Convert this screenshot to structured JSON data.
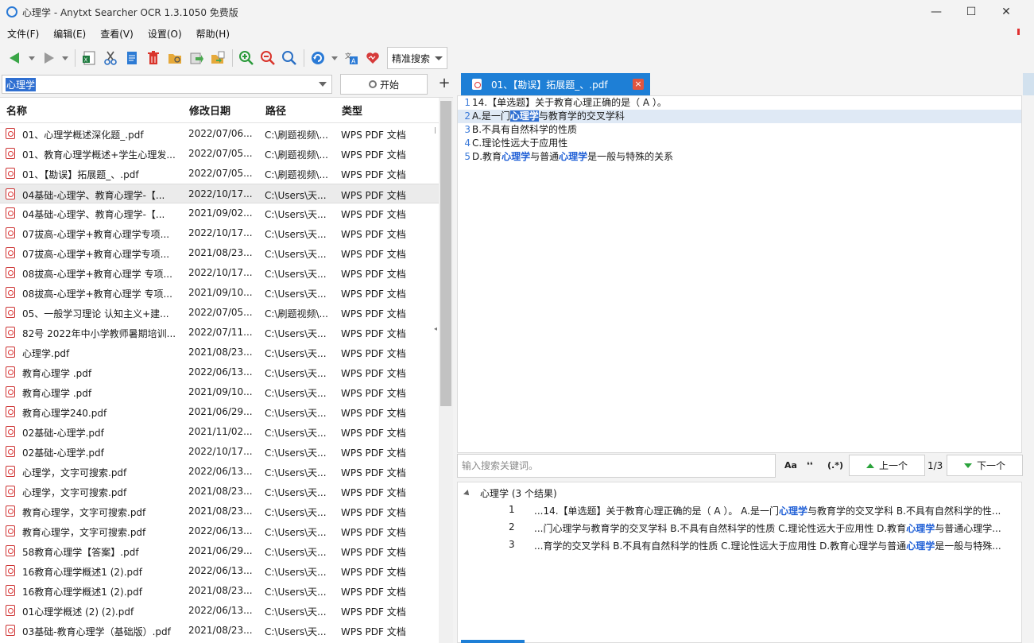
{
  "window": {
    "title": "心理学 - Anytxt Searcher OCR 1.3.1050 免费版",
    "minimize": "—",
    "maximize": "☐",
    "close": "✕"
  },
  "menu": [
    "文件(F)",
    "编辑(E)",
    "查看(V)",
    "设置(O)",
    "帮助(H)"
  ],
  "toolbar": {
    "icons": [
      "back-icon",
      "forward-icon",
      "excel-export-icon",
      "cut-icon",
      "document-icon",
      "delete-icon",
      "open-folder-icon",
      "copy-to-icon",
      "move-to-icon",
      "zoom-in-icon",
      "zoom-out-icon",
      "search-icon",
      "refresh-icon",
      "translate-icon",
      "favorite-icon"
    ],
    "mode": "精准搜索"
  },
  "search": {
    "query": "心理学",
    "start_label": "开始",
    "add_label": "+"
  },
  "tab": {
    "title": "01、【勘误】拓展题_、.pdf",
    "close": "×"
  },
  "list": {
    "headers": {
      "name": "名称",
      "date": "修改日期",
      "path": "路径",
      "type": "类型"
    },
    "selected_index": 3,
    "rows": [
      {
        "name": "01、心理学概述深化题_.pdf",
        "date": "2022/07/06...",
        "path": "C:\\刷题视频\\...",
        "type": "WPS PDF 文档"
      },
      {
        "name": "01、教育心理学概述+学生心理发...",
        "date": "2022/07/05...",
        "path": "C:\\刷题视频\\...",
        "type": "WPS PDF 文档"
      },
      {
        "name": "01、【勘误】拓展题_、.pdf",
        "date": "2022/07/05...",
        "path": "C:\\刷题视频\\...",
        "type": "WPS PDF 文档"
      },
      {
        "name": "04基础-心理学、教育心理学-【...",
        "date": "2022/10/17...",
        "path": "C:\\Users\\天...",
        "type": "WPS PDF 文档"
      },
      {
        "name": "04基础-心理学、教育心理学-【...",
        "date": "2021/09/02...",
        "path": "C:\\Users\\天...",
        "type": "WPS PDF 文档"
      },
      {
        "name": "07拔高-心理学+教育心理学专项...",
        "date": "2022/10/17...",
        "path": "C:\\Users\\天...",
        "type": "WPS PDF 文档"
      },
      {
        "name": "07拔高-心理学+教育心理学专项...",
        "date": "2021/08/23...",
        "path": "C:\\Users\\天...",
        "type": "WPS PDF 文档"
      },
      {
        "name": "08拔高-心理学+教育心理学 专项...",
        "date": "2022/10/17...",
        "path": "C:\\Users\\天...",
        "type": "WPS PDF 文档"
      },
      {
        "name": "08拔高-心理学+教育心理学 专项...",
        "date": "2021/09/10...",
        "path": "C:\\Users\\天...",
        "type": "WPS PDF 文档"
      },
      {
        "name": "05、一般学习理论 认知主义+建...",
        "date": "2022/07/05...",
        "path": "C:\\刷题视频\\...",
        "type": "WPS PDF 文档"
      },
      {
        "name": "82号 2022年中小学教师暑期培训...",
        "date": "2022/07/11...",
        "path": "C:\\Users\\天...",
        "type": "WPS PDF 文档"
      },
      {
        "name": "心理学.pdf",
        "date": "2021/08/23...",
        "path": "C:\\Users\\天...",
        "type": "WPS PDF 文档"
      },
      {
        "name": "教育心理学 .pdf",
        "date": "2022/06/13...",
        "path": "C:\\Users\\天...",
        "type": "WPS PDF 文档"
      },
      {
        "name": "教育心理学 .pdf",
        "date": "2021/09/10...",
        "path": "C:\\Users\\天...",
        "type": "WPS PDF 文档"
      },
      {
        "name": "教育心理学240.pdf",
        "date": "2021/06/29...",
        "path": "C:\\Users\\天...",
        "type": "WPS PDF 文档"
      },
      {
        "name": "02基础-心理学.pdf",
        "date": "2021/11/02...",
        "path": "C:\\Users\\天...",
        "type": "WPS PDF 文档"
      },
      {
        "name": "02基础-心理学.pdf",
        "date": "2022/10/17...",
        "path": "C:\\Users\\天...",
        "type": "WPS PDF 文档"
      },
      {
        "name": "心理学，文字可搜索.pdf",
        "date": "2022/06/13...",
        "path": "C:\\Users\\天...",
        "type": "WPS PDF 文档"
      },
      {
        "name": "心理学，文字可搜索.pdf",
        "date": "2021/08/23...",
        "path": "C:\\Users\\天...",
        "type": "WPS PDF 文档"
      },
      {
        "name": "教育心理学，文字可搜索.pdf",
        "date": "2021/08/23...",
        "path": "C:\\Users\\天...",
        "type": "WPS PDF 文档"
      },
      {
        "name": "教育心理学，文字可搜索.pdf",
        "date": "2022/06/13...",
        "path": "C:\\Users\\天...",
        "type": "WPS PDF 文档"
      },
      {
        "name": "58教育心理学【答案】.pdf",
        "date": "2021/06/29...",
        "path": "C:\\Users\\天...",
        "type": "WPS PDF 文档"
      },
      {
        "name": "16教育心理学概述1 (2).pdf",
        "date": "2022/06/13...",
        "path": "C:\\Users\\天...",
        "type": "WPS PDF 文档"
      },
      {
        "name": "16教育心理学概述1 (2).pdf",
        "date": "2021/08/23...",
        "path": "C:\\Users\\天...",
        "type": "WPS PDF 文档"
      },
      {
        "name": "01心理学概述 (2) (2).pdf",
        "date": "2022/06/13...",
        "path": "C:\\Users\\天...",
        "type": "WPS PDF 文档"
      },
      {
        "name": "03基础-教育心理学（基础版）.pdf",
        "date": "2021/08/23...",
        "path": "C:\\Users\\天...",
        "type": "WPS PDF 文档"
      }
    ]
  },
  "preview": {
    "current_line": 2,
    "lines": [
      [
        {
          "t": "14.【单选题】关于教育心理正确的是（ A ）。"
        }
      ],
      [
        {
          "t": "A.是一门"
        },
        {
          "t": "心理学",
          "h": "box"
        },
        {
          "t": "与教育学的交叉学科"
        }
      ],
      [
        {
          "t": "B.不具有自然科学的性质"
        }
      ],
      [
        {
          "t": "C.理论性远大于应用性"
        }
      ],
      [
        {
          "t": "D.教育"
        },
        {
          "t": "心理学",
          "h": "hl"
        },
        {
          "t": "与普通"
        },
        {
          "t": "心理学",
          "h": "hl"
        },
        {
          "t": "是一般与特殊的关系"
        }
      ]
    ]
  },
  "find": {
    "placeholder": "输入搜索关键词。",
    "opt_case": "Aa",
    "opt_word": "❛❛",
    "opt_regex": "(.*)",
    "prev_label": "上一个",
    "next_label": "下一个",
    "counter": "1/3"
  },
  "results": {
    "group_label": "心理学 (3 个结果)",
    "items": [
      {
        "num": "1",
        "parts": [
          {
            "t": "...14.【单选题】关于教育心理正确的是（ A ）。 A.是一门"
          },
          {
            "t": "心理学",
            "h": "hl"
          },
          {
            "t": "与教育学的交叉学科 B.不具有自然科学的性..."
          }
        ]
      },
      {
        "num": "2",
        "parts": [
          {
            "t": "...门心理学与教育学的交叉学科 B.不具有自然科学的性质 C.理论性远大于应用性 D.教育"
          },
          {
            "t": "心理学",
            "h": "hl"
          },
          {
            "t": "与普通心理学..."
          }
        ]
      },
      {
        "num": "3",
        "parts": [
          {
            "t": "...育学的交叉学科 B.不具有自然科学的性质 C.理论性远大于应用性 D.教育心理学与普通"
          },
          {
            "t": "心理学",
            "h": "hl"
          },
          {
            "t": "是一般与特殊..."
          }
        ]
      }
    ]
  },
  "colors": {
    "accent": "#1e7fd6",
    "highlight": "#1f5fd6",
    "selection": "#2f6fd1"
  }
}
